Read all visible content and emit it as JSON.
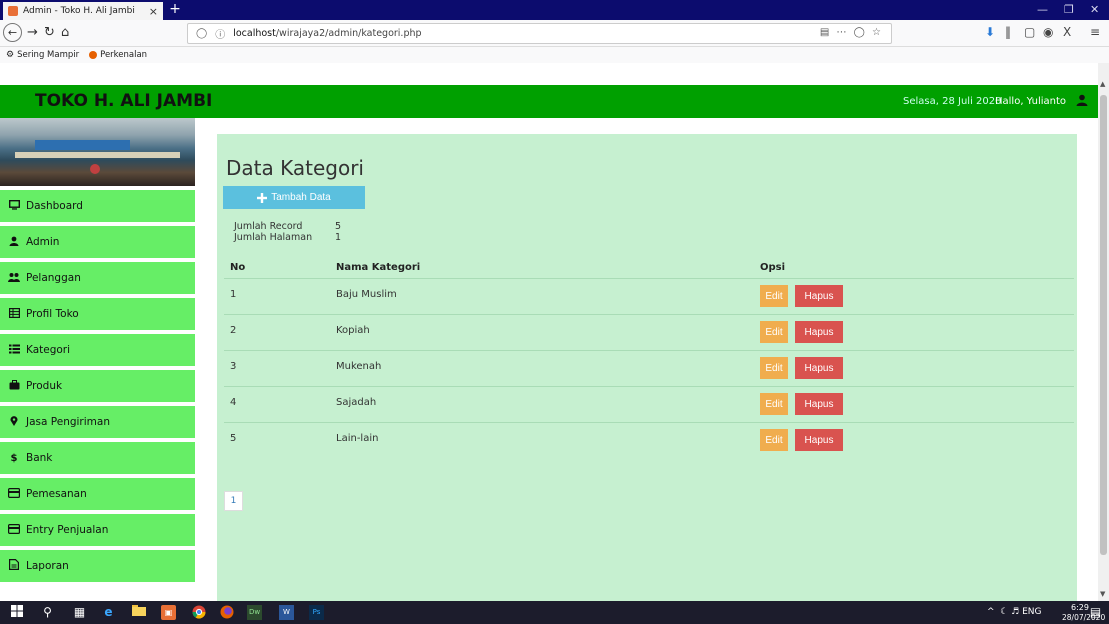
{
  "browser": {
    "tab_title": "Admin - Toko H. Ali Jambi",
    "tab_close": "×",
    "new_tab": "+",
    "url_host": "localhost",
    "url_path": "/wirajaya2/admin/kategori.php",
    "bookmarks": [
      "Sering Mampir",
      "Perkenalan"
    ]
  },
  "header": {
    "brand": "TOKO H. ALI JAMBI",
    "date": "Selasa, 28 Juli 2020",
    "greeting": "Hallo, Yulianto"
  },
  "sidebar": {
    "items": [
      {
        "label": "Dashboard",
        "icon": "monitor-icon"
      },
      {
        "label": "Admin",
        "icon": "user-icon"
      },
      {
        "label": "Pelanggan",
        "icon": "users-icon"
      },
      {
        "label": "Profil Toko",
        "icon": "table-icon"
      },
      {
        "label": "Kategori",
        "icon": "list-icon"
      },
      {
        "label": "Produk",
        "icon": "briefcase-icon"
      },
      {
        "label": "Jasa Pengiriman",
        "icon": "map-marker-icon"
      },
      {
        "label": "Bank",
        "icon": "dollar-icon"
      },
      {
        "label": "Pemesanan",
        "icon": "credit-card-icon"
      },
      {
        "label": "Entry Penjualan",
        "icon": "credit-card-icon"
      },
      {
        "label": "Laporan",
        "icon": "file-icon"
      }
    ]
  },
  "main": {
    "title": "Data Kategori",
    "add_button": "Tambah Data",
    "record_label": "Jumlah Record",
    "record_value": "5",
    "pages_label": "Jumlah Halaman",
    "pages_value": "1",
    "columns": [
      "No",
      "Nama Kategori",
      "Opsi"
    ],
    "rows": [
      {
        "no": "1",
        "name": "Baju Muslim"
      },
      {
        "no": "2",
        "name": "Kopiah"
      },
      {
        "no": "3",
        "name": "Mukenah"
      },
      {
        "no": "4",
        "name": "Sajadah"
      },
      {
        "no": "5",
        "name": "Lain-lain"
      }
    ],
    "edit_label": "Edit",
    "delete_label": "Hapus",
    "page": "1"
  },
  "taskbar": {
    "language": "ENG",
    "time": "6:29",
    "date": "28/07/2020"
  },
  "colors": {
    "header_green": "#00a000",
    "sidebar_green": "#66ee66",
    "panel_bg": "#c6f0d0",
    "add_button": "#5bc0de",
    "edit_button": "#f0ad4e",
    "delete_button": "#d9534f"
  }
}
